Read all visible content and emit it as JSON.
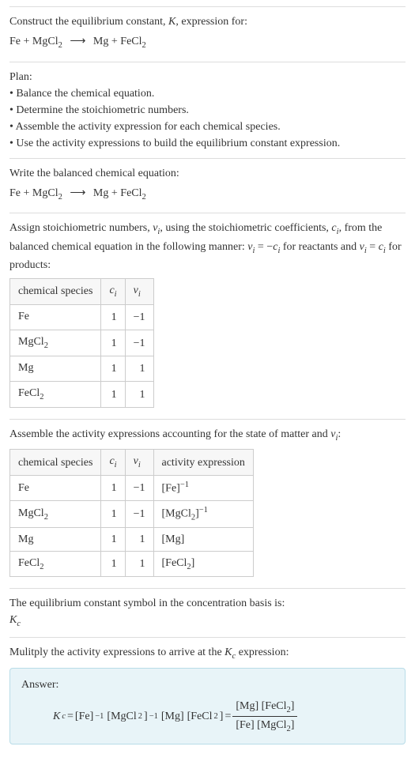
{
  "header": {
    "line1_prefix": "Construct the equilibrium constant, ",
    "line1_K": "K",
    "line1_suffix": ", expression for:",
    "eq_lhs1": "Fe",
    "eq_plus": " + ",
    "eq_lhs2": "MgCl",
    "eq_lhs2_sub": "2",
    "eq_arrow": "⟶",
    "eq_rhs1": "Mg",
    "eq_rhs2": "FeCl",
    "eq_rhs2_sub": "2"
  },
  "plan": {
    "title": "Plan:",
    "b1": "• Balance the chemical equation.",
    "b2": "• Determine the stoichiometric numbers.",
    "b3": "• Assemble the activity expression for each chemical species.",
    "b4": "• Use the activity expressions to build the equilibrium constant expression."
  },
  "balanced": {
    "title": "Write the balanced chemical equation:"
  },
  "stoich": {
    "intro_a": "Assign stoichiometric numbers, ",
    "intro_nu": "ν",
    "intro_i": "i",
    "intro_b": ", using the stoichiometric coefficients, ",
    "intro_c": "c",
    "intro_c2": ", from the balanced chemical equation in the following manner: ",
    "rel1a": "ν",
    "rel1b": "i",
    "rel1eq": " = −",
    "rel1c": "c",
    "rel1d": "i",
    "rel1suf": " for reactants and ",
    "rel2a": "ν",
    "rel2b": "i",
    "rel2eq": " = ",
    "rel2c": "c",
    "rel2d": "i",
    "rel2suf": " for products:"
  },
  "table1": {
    "h1": "chemical species",
    "h2c": "c",
    "h2i": "i",
    "h3n": "ν",
    "h3i": "i",
    "rows": [
      {
        "sp": "Fe",
        "spsub": "",
        "c": "1",
        "n": "−1"
      },
      {
        "sp": "MgCl",
        "spsub": "2",
        "c": "1",
        "n": "−1"
      },
      {
        "sp": "Mg",
        "spsub": "",
        "c": "1",
        "n": "1"
      },
      {
        "sp": "FeCl",
        "spsub": "2",
        "c": "1",
        "n": "1"
      }
    ]
  },
  "activity": {
    "intro_a": "Assemble the activity expressions accounting for the state of matter and ",
    "intro_nu": "ν",
    "intro_i": "i",
    "intro_b": ":"
  },
  "table2": {
    "h1": "chemical species",
    "h2c": "c",
    "h2i": "i",
    "h3n": "ν",
    "h3i": "i",
    "h4": "activity expression",
    "rows": [
      {
        "sp": "Fe",
        "spsub": "",
        "c": "1",
        "n": "−1",
        "act_open": "[Fe]",
        "act_sup": "−1"
      },
      {
        "sp": "MgCl",
        "spsub": "2",
        "c": "1",
        "n": "−1",
        "act_open": "[MgCl",
        "act_sub": "2",
        "act_close": "]",
        "act_sup": "−1"
      },
      {
        "sp": "Mg",
        "spsub": "",
        "c": "1",
        "n": "1",
        "act_open": "[Mg]",
        "act_sup": ""
      },
      {
        "sp": "FeCl",
        "spsub": "2",
        "c": "1",
        "n": "1",
        "act_open": "[FeCl",
        "act_sub": "2",
        "act_close": "]",
        "act_sup": ""
      }
    ]
  },
  "kbasis": {
    "line": "The equilibrium constant symbol in the concentration basis is:",
    "sym": "K",
    "symsub": "c"
  },
  "mult": {
    "a": "Mulitply the activity expressions to arrive at the ",
    "k": "K",
    "ksub": "c",
    "b": " expression:"
  },
  "answer": {
    "label": "Answer:",
    "Kc_K": "K",
    "Kc_c": "c",
    "eq": " = ",
    "t1": "[Fe]",
    "t1sup": "−1",
    "sp": " ",
    "t2a": "[MgCl",
    "t2sub": "2",
    "t2b": "]",
    "t2sup": "−1",
    "t3": "[Mg]",
    "t4a": "[FeCl",
    "t4sub": "2",
    "t4b": "]",
    "eq2": " = ",
    "num_a": "[Mg] [FeCl",
    "num_sub": "2",
    "num_b": "]",
    "den_a": "[Fe] [MgCl",
    "den_sub": "2",
    "den_b": "]"
  }
}
